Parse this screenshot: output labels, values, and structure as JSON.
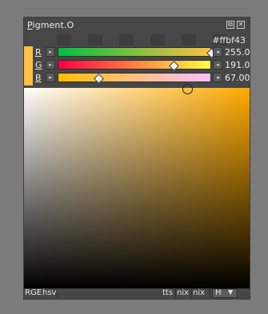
{
  "window": {
    "title_first_letter": "P",
    "title_rest": "igment.O",
    "float_icon": "float-icon",
    "close_icon": "close-icon"
  },
  "hex_value": "#ffbf43",
  "current_color": "#ffbf43",
  "channels": [
    {
      "label": "R",
      "value": "255.00",
      "level": 1.0
    },
    {
      "label": "G",
      "value": "191.00",
      "level": 0.749
    },
    {
      "label": "B",
      "value": "67.00",
      "level": 0.263
    }
  ],
  "picker": {
    "hue_color": "#ffaa00"
  },
  "bottom_tabs": {
    "left_1": "RGE",
    "left_2": "hsv",
    "right_1": "tts",
    "right_2": "nix",
    "right_3": "nix",
    "dropdown": "H"
  }
}
